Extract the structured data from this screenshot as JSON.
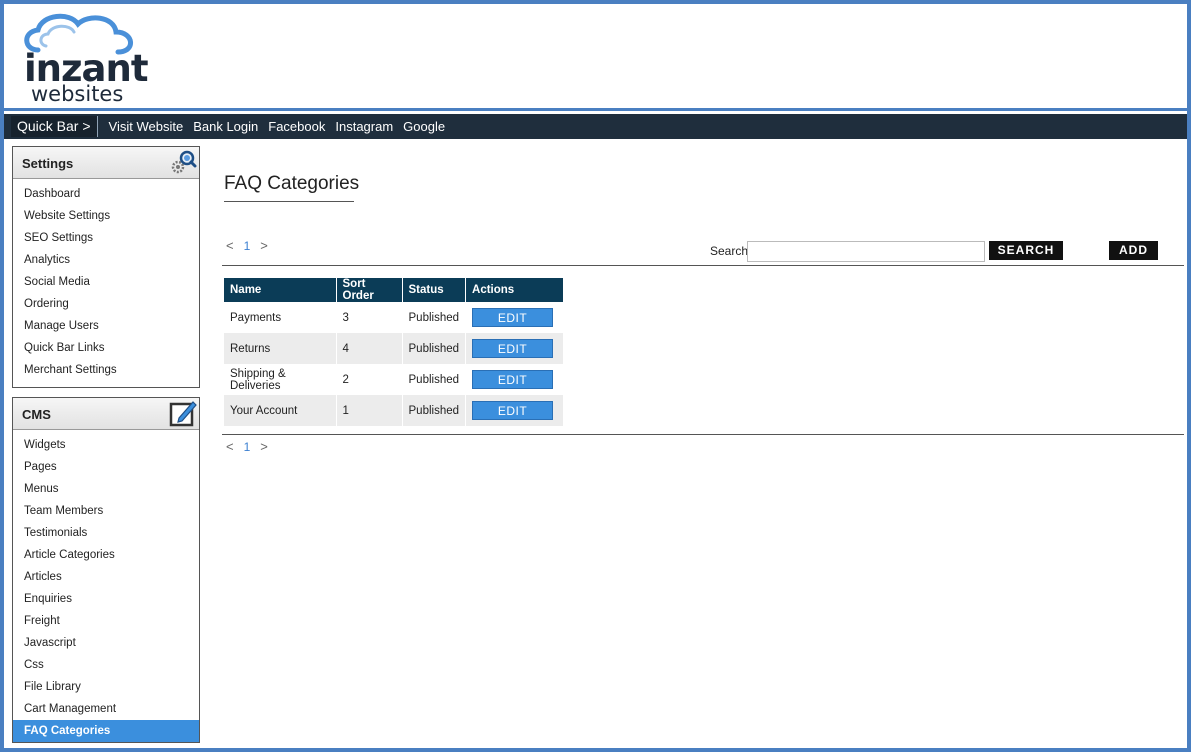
{
  "logo": {
    "main": "inzant",
    "sub": "websites"
  },
  "quickbar": {
    "label": "Quick Bar >",
    "links": [
      "Visit Website",
      "Bank Login",
      "Facebook",
      "Instagram",
      "Google"
    ]
  },
  "sidebar": {
    "settings": {
      "title": "Settings",
      "icon": "gears-search-icon",
      "items": [
        "Dashboard",
        "Website Settings",
        "SEO Settings",
        "Analytics",
        "Social Media",
        "Ordering",
        "Manage Users",
        "Quick Bar Links",
        "Merchant Settings"
      ]
    },
    "cms": {
      "title": "CMS",
      "icon": "edit-pencil-icon",
      "items": [
        "Widgets",
        "Pages",
        "Menus",
        "Team Members",
        "Testimonials",
        "Article Categories",
        "Articles",
        "Enquiries",
        "Freight",
        "Javascript",
        "Css",
        "File Library",
        "Cart Management",
        "FAQ Categories"
      ],
      "active": "FAQ Categories"
    }
  },
  "main": {
    "title": "FAQ Categories",
    "pager": {
      "prev": "<",
      "page": "1",
      "next": ">"
    },
    "search": {
      "label": "Search",
      "value": "",
      "button": "SEARCH"
    },
    "add_label": "ADD",
    "table": {
      "headers": [
        "Name",
        "Sort Order",
        "Status",
        "Actions"
      ],
      "rows": [
        {
          "name": "Payments",
          "sort": "3",
          "status": "Published",
          "action": "EDIT"
        },
        {
          "name": "Returns",
          "sort": "4",
          "status": "Published",
          "action": "EDIT"
        },
        {
          "name": "Shipping & Deliveries",
          "sort": "2",
          "status": "Published",
          "action": "EDIT"
        },
        {
          "name": "Your Account",
          "sort": "1",
          "status": "Published",
          "action": "EDIT"
        }
      ]
    }
  },
  "colors": {
    "accent": "#3b8fdd",
    "header_bar": "#1f2e3d",
    "table_header": "#0b3c57",
    "frame": "#4a7fc1"
  }
}
